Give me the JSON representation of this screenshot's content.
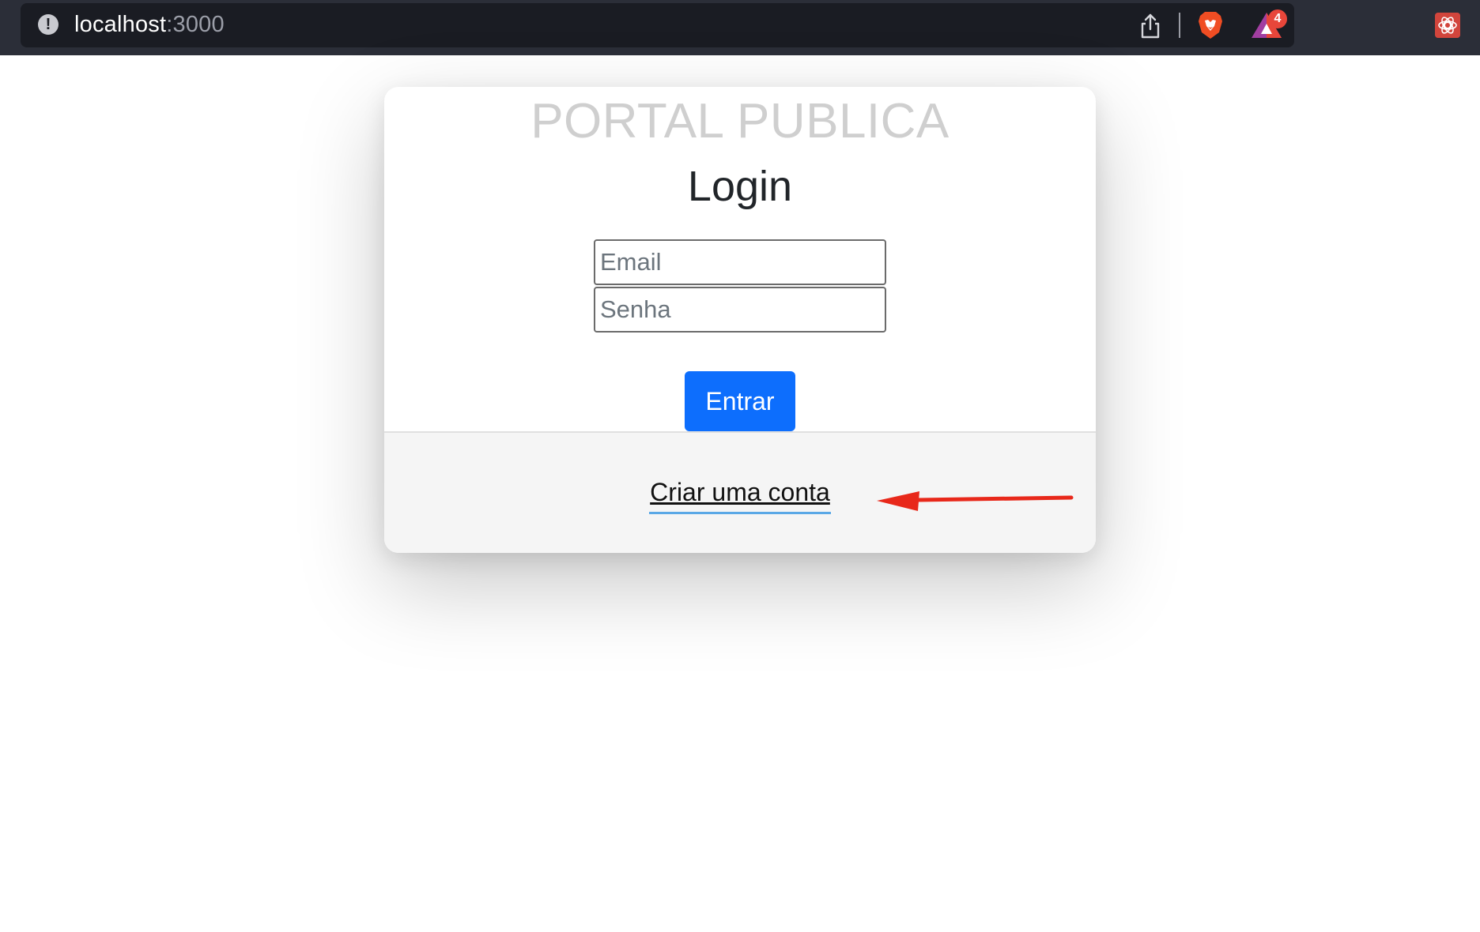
{
  "browser": {
    "url_host": "localhost",
    "url_port": ":3000",
    "rewards_badge_count": "4",
    "icons": [
      "site-info-icon",
      "share-icon",
      "brave-shield-icon",
      "brave-rewards-icon",
      "extension-icon"
    ]
  },
  "page": {
    "brand_title": "PORTAL PUBLICA",
    "login_title": "Login",
    "email_placeholder": "Email",
    "password_placeholder": "Senha",
    "submit_label": "Entrar",
    "signup_link": "Criar uma conta"
  },
  "colors": {
    "primary_button": "#0d6efd",
    "annotation_arrow": "#e8281a",
    "brand_title": "#cfcfcf",
    "chrome_background": "#2b2e38"
  }
}
